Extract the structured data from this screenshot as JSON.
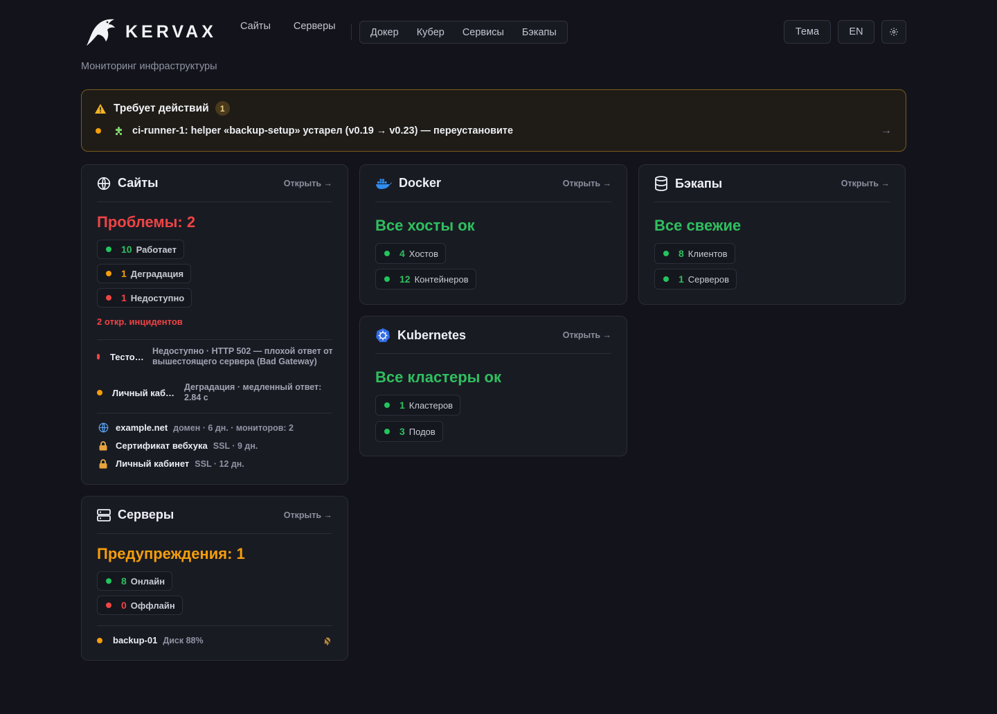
{
  "brand": {
    "name": "KERVAX",
    "subtitle": "Мониторинг инфраструктуры"
  },
  "nav": {
    "main": [
      "Сайты",
      "Серверы"
    ],
    "group": [
      "Докер",
      "Кубер",
      "Сервисы",
      "Бэкапы"
    ],
    "theme_label": "Тема",
    "lang_label": "EN"
  },
  "alert": {
    "title": "Требует действий",
    "count": "1",
    "message": "ci-runner-1: helper «backup-setup» устарел (v0.19 → v0.23) — переустановите",
    "arrow": "→"
  },
  "open_label": "Открыть →",
  "sites": {
    "title": "Сайты",
    "status": "Проблемы: 2",
    "stats": [
      {
        "value": "10",
        "label": "Работает",
        "color": "#22c55e"
      },
      {
        "value": "1",
        "label": "Деградация",
        "color": "#f59e0b"
      },
      {
        "value": "1",
        "label": "Недоступно",
        "color": "#ef4444"
      }
    ],
    "open_incidents": "2 откр. инцидентов",
    "incidents": [
      {
        "name": "Тесто…",
        "desc": "Недоступно · HTTP 502 — плохой ответ от вышестоящего сервера (Bad Gateway)"
      },
      {
        "name": "Личный каб…",
        "desc": "Деградация · медленный ответ: 2.84 с"
      }
    ],
    "domains": [
      {
        "name": "example.net",
        "meta": "домен · 6 дн. · мониторов: 2",
        "icon": "globe-icon"
      },
      {
        "name": "Сертификат вебхука",
        "meta": "SSL · 9 дн.",
        "icon": "lock-icon"
      },
      {
        "name": "Личный кабинет",
        "meta": "SSL · 12 дн.",
        "icon": "lock-icon"
      }
    ]
  },
  "servers": {
    "title": "Серверы",
    "status": "Предупреждения: 1",
    "stats": [
      {
        "value": "8",
        "label": "Онлайн"
      },
      {
        "value": "0",
        "label": "Оффлайн"
      }
    ],
    "warning_row": {
      "name": "backup-01",
      "meta": "Диск 88%"
    }
  },
  "docker": {
    "title": "Docker",
    "status": "Все хосты ок",
    "stats": [
      {
        "value": "4",
        "label": "Хостов"
      },
      {
        "value": "12",
        "label": "Контейнеров"
      }
    ]
  },
  "kubernetes": {
    "title": "Kubernetes",
    "status": "Все кластеры ок",
    "stats": [
      {
        "value": "1",
        "label": "Кластеров"
      },
      {
        "value": "3",
        "label": "Подов"
      }
    ]
  },
  "backups": {
    "title": "Бэкапы",
    "status": "Все свежие",
    "stats": [
      {
        "value": "8",
        "label": "Клиентов"
      },
      {
        "value": "1",
        "label": "Серверов"
      }
    ]
  }
}
